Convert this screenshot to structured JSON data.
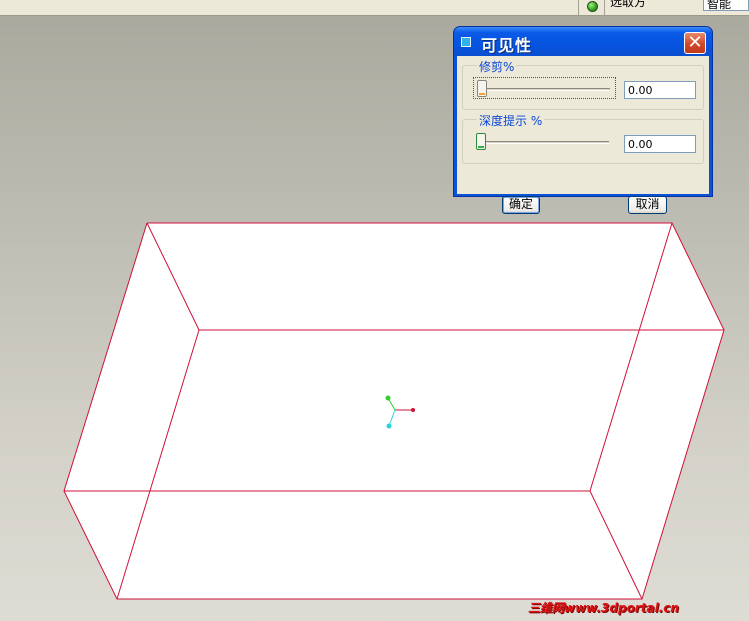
{
  "toolbar": {
    "cut_text": "选取方",
    "filter_value": "智能",
    "status_indicator": "green-status-light"
  },
  "dialog": {
    "title": "可见性",
    "title_icon": "square-window-icon",
    "close_icon": "close-x-icon",
    "trim": {
      "label": "修剪%",
      "value": "0.00",
      "slider_fraction": 0
    },
    "depth_cue": {
      "label": "深度提示 %",
      "value": "0.00",
      "slider_fraction": 0
    },
    "ok_label": "确定",
    "cancel_label": "取消"
  },
  "watermark": "三维网www.3dportal.cn",
  "colors": {
    "model_edges": "#d0103a",
    "title_bar": "#0a5ae8",
    "triad_x": "#d0103a",
    "triad_y": "#2fd02f",
    "triad_z": "#27d3d8"
  }
}
